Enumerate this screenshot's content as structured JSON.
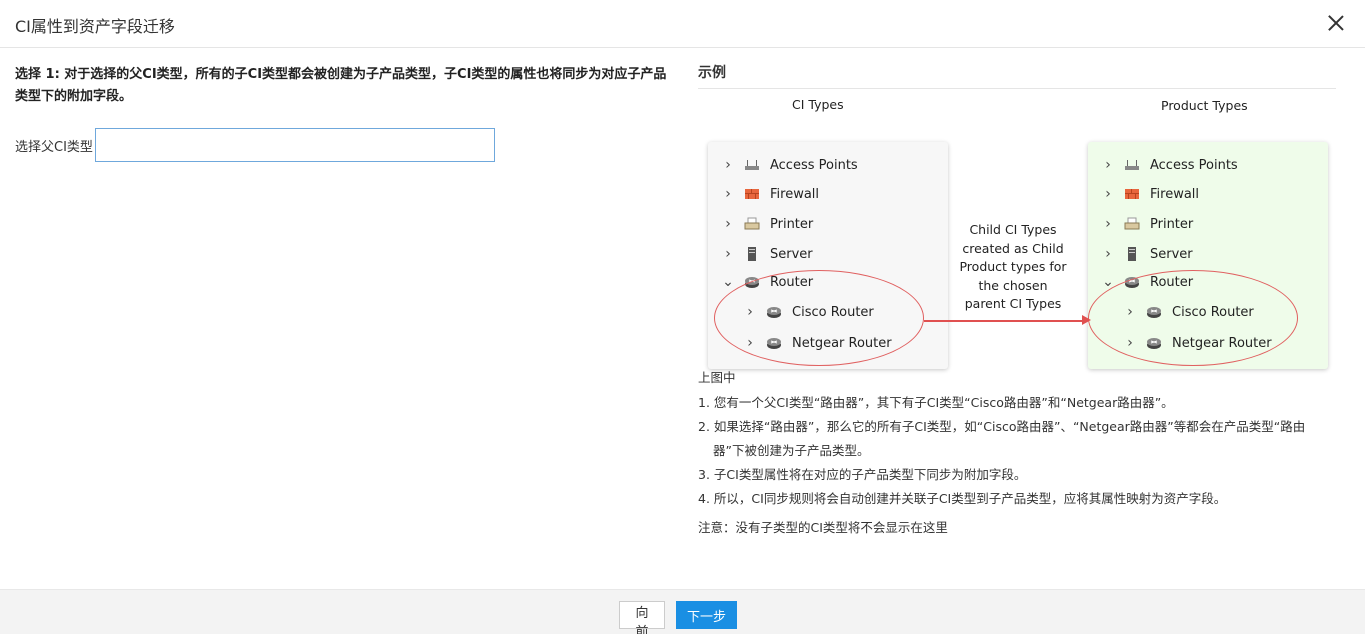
{
  "dialog": {
    "title": "CI属性到资产字段迁移",
    "close_icon": "close-icon"
  },
  "left": {
    "step_text": "选择 1: 对于选择的父CI类型，所有的子CI类型都会被创建为子产品类型，子CI类型的属性也将同步为对应子产品类型下的附加字段。",
    "parent_label": "选择父CI类型",
    "parent_value": "",
    "parent_placeholder": ""
  },
  "example": {
    "title": "示例",
    "ci_label": "CI Types",
    "product_label": "Product Types",
    "ci_items": [
      "Access Points",
      "Firewall",
      "Printer",
      "Server",
      "Router",
      "Cisco Router",
      "Netgear Router"
    ],
    "product_items": [
      "Access Points",
      "Firewall",
      "Printer",
      "Server",
      "Router",
      "Cisco Router",
      "Netgear Router"
    ],
    "middle_text": "Child CI Types created as Child Product types for the chosen parent CI Types",
    "icons": [
      "access-point-icon",
      "firewall-icon",
      "printer-icon",
      "server-icon",
      "router-icon",
      "router-icon",
      "router-icon"
    ],
    "highlight_color": "#e06060",
    "product_panel_bg": "#effcea"
  },
  "notes": {
    "heading": "上图中",
    "items": [
      "1. 您有一个父CI类型“路由器”，其下有子CI类型“Cisco路由器”和“Netgear路由器”。",
      "2. 如果选择“路由器”，那么它的所有子CI类型，如“Cisco路由器”、“Netgear路由器”等都会在产品类型“路由器”下被创建为子产品类型。",
      "3. 子CI类型属性将在对应的子产品类型下同步为附加字段。",
      "4. 所以，CI同步规则将会自动创建并关联子CI类型到子产品类型，应将其属性映射为资产字段。"
    ],
    "notice": "注意：没有子类型的CI类型将不会显示在这里"
  },
  "footer": {
    "prev_label": "向前",
    "next_label": "下一步",
    "next_color": "#1a8fe3"
  }
}
